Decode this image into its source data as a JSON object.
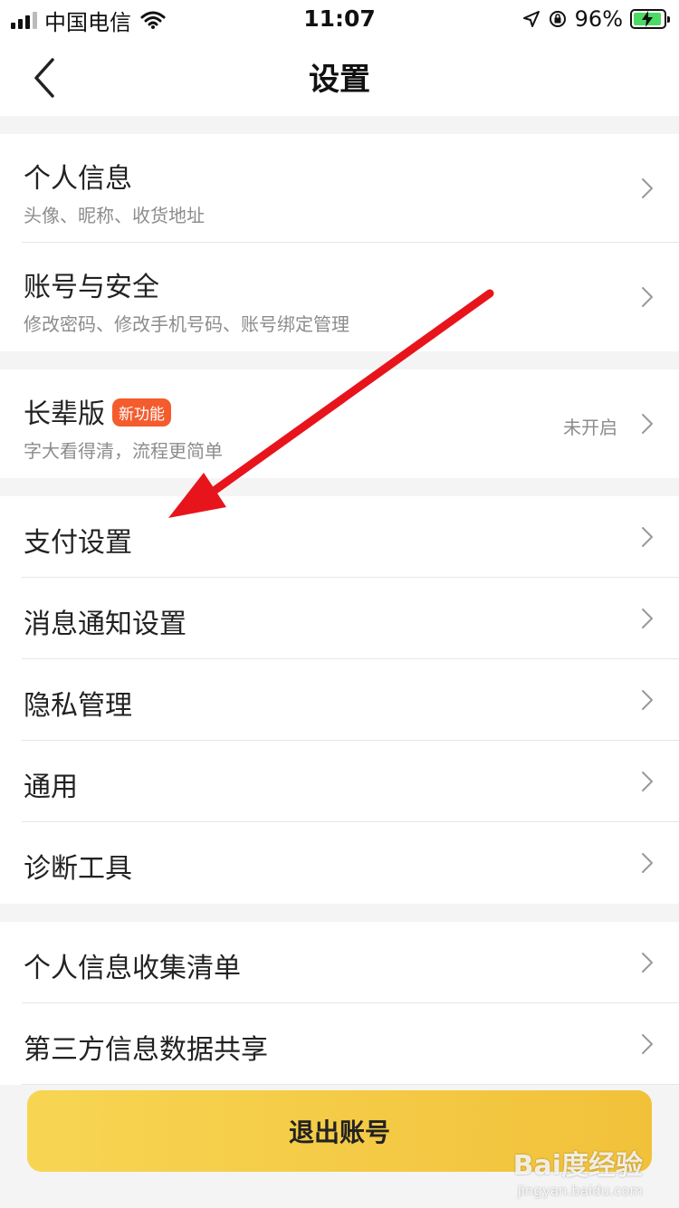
{
  "status_bar": {
    "carrier": "中国电信",
    "time": "11:07",
    "battery": "96%"
  },
  "nav": {
    "title": "设置"
  },
  "group1": {
    "items": [
      {
        "title": "个人信息",
        "subtitle": "头像、昵称、收货地址"
      },
      {
        "title": "账号与安全",
        "subtitle": "修改密码、修改手机号码、账号绑定管理"
      }
    ]
  },
  "group2": {
    "item": {
      "title": "长辈版",
      "badge": "新功能",
      "subtitle": "字大看得清，流程更简单",
      "value": "未开启"
    }
  },
  "group3": {
    "items": [
      {
        "title": "支付设置"
      },
      {
        "title": "消息通知设置"
      },
      {
        "title": "隐私管理"
      },
      {
        "title": "通用"
      },
      {
        "title": "诊断工具"
      }
    ]
  },
  "group4": {
    "items": [
      {
        "title": "个人信息收集清单"
      },
      {
        "title": "第三方信息数据共享"
      }
    ]
  },
  "logout": {
    "label": "退出账号"
  },
  "watermark": {
    "logo": "Bai度经验",
    "url": "jingyan.baidu.com"
  },
  "colors": {
    "accent": "#f2c13a",
    "badge": "#f45c2e",
    "arrow": "#e8141b"
  },
  "icons": [
    "back-chevron-icon",
    "chevron-right-icon",
    "wifi-icon",
    "location-icon",
    "rotation-lock-icon",
    "battery-icon"
  ]
}
